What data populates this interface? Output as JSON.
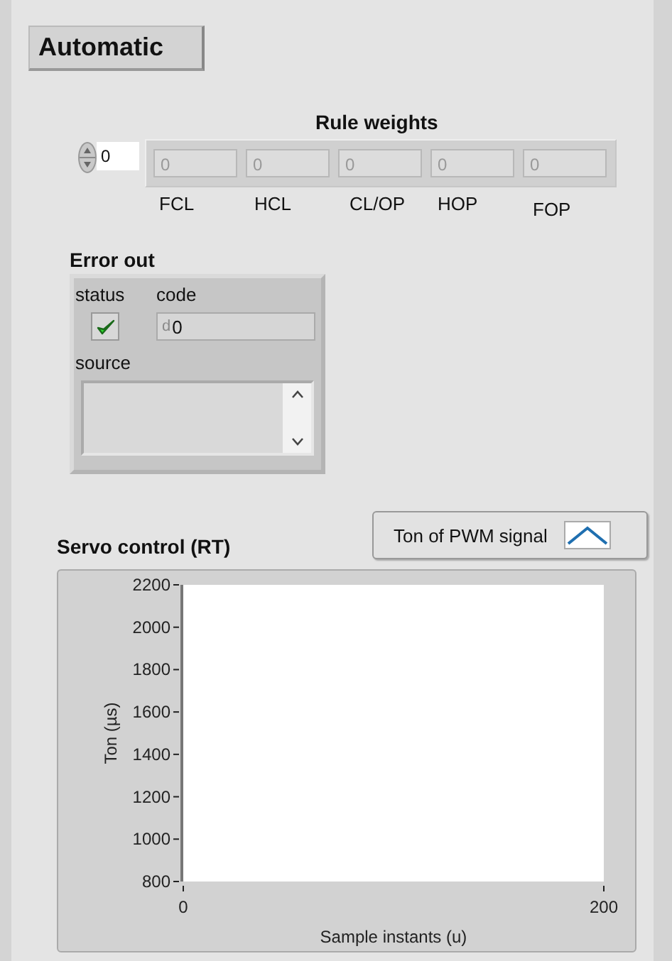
{
  "mode_button": {
    "label": "Automatic"
  },
  "rule_weights": {
    "title": "Rule weights",
    "index": "0",
    "cells": [
      "0",
      "0",
      "0",
      "0",
      "0"
    ],
    "labels": [
      "FCL",
      "HCL",
      "CL/OP",
      "HOP",
      "FOP"
    ]
  },
  "error_out": {
    "title": "Error out",
    "status_label": "status",
    "status": {
      "checked": true
    },
    "code_label": "code",
    "code_radix": "d",
    "code": "0",
    "source_label": "source"
  },
  "graph": {
    "title": "Servo control (RT)",
    "legend": [
      "Ton of PWM signal"
    ],
    "xlabel": "Sample instants (u)",
    "ylabel": "Ton (µs)",
    "x_tick_labels": [
      "0",
      "200"
    ],
    "y_tick_labels": [
      "2200",
      "2000",
      "1800",
      "1600",
      "1400",
      "1200",
      "1000",
      "800"
    ]
  }
}
